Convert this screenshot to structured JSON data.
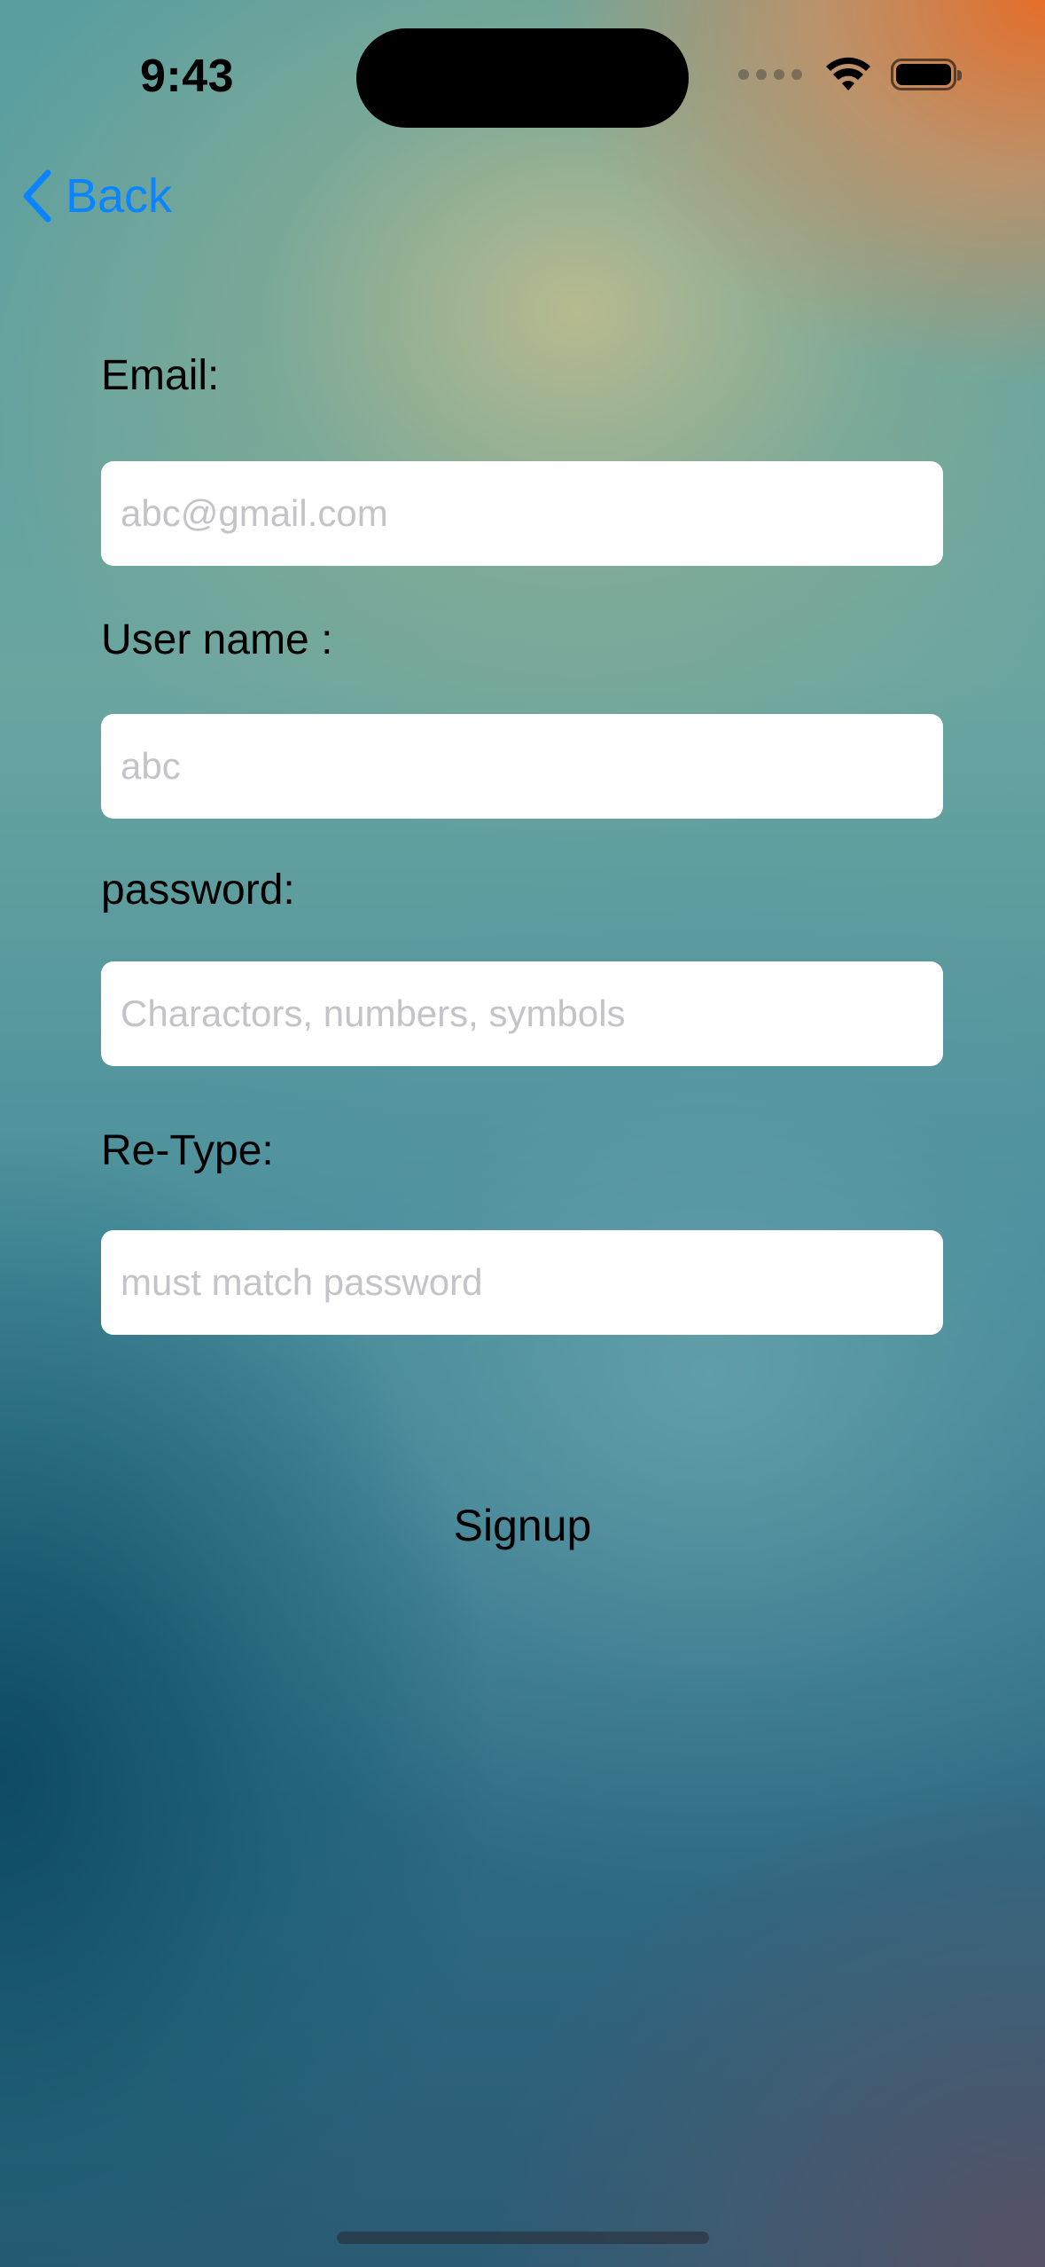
{
  "status_bar": {
    "time": "9:43"
  },
  "nav": {
    "back_label": "Back"
  },
  "form": {
    "email": {
      "label": "Email:",
      "placeholder": "abc@gmail.com",
      "value": ""
    },
    "username": {
      "label": "User name :",
      "placeholder": "abc",
      "value": ""
    },
    "password": {
      "label": "password:",
      "placeholder": "Charactors, numbers, symbols",
      "value": ""
    },
    "retype": {
      "label": "Re-Type:",
      "placeholder": "must match password",
      "value": ""
    },
    "submit_label": "Signup"
  },
  "icons": {
    "back": "chevron-left-icon",
    "signal": "cellular-signal-icon",
    "wifi": "wifi-icon",
    "battery": "battery-icon"
  },
  "colors": {
    "accent": "#0a84ff",
    "field_background": "#ffffff",
    "placeholder": "#c4c4c8"
  }
}
